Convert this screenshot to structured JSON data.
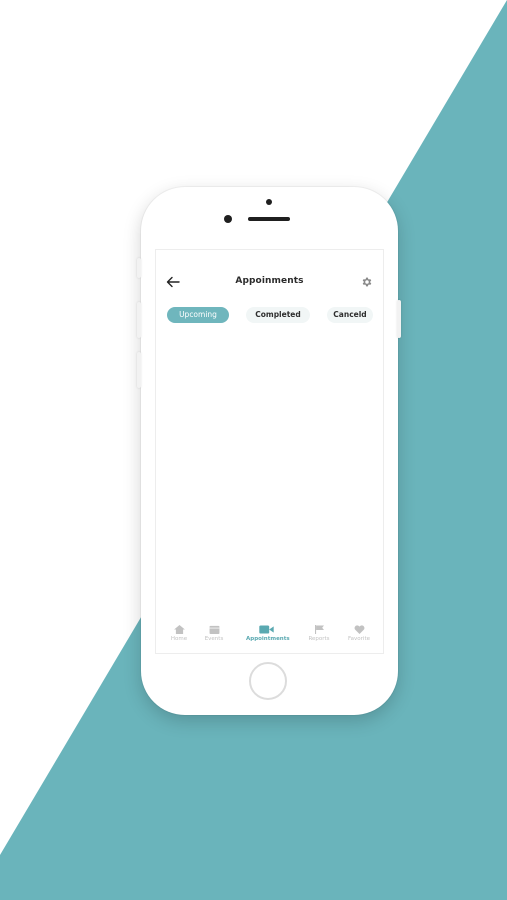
{
  "colors": {
    "accent": "#6fb6bd",
    "background_shape": "#6ab4bb",
    "tab_inactive_bg": "#f1f6f6",
    "nav_inactive": "#c2c2c2"
  },
  "header": {
    "title": "Appoinments",
    "back_icon": "arrow-left-icon",
    "settings_icon": "gear-icon"
  },
  "tabs": [
    {
      "label": "Upcoming",
      "active": true
    },
    {
      "label": "Completed",
      "active": false
    },
    {
      "label": "Canceld",
      "active": false
    }
  ],
  "bottom_nav": [
    {
      "label": "Home",
      "icon": "home-icon",
      "active": false
    },
    {
      "label": "Events",
      "icon": "calendar-icon",
      "active": false
    },
    {
      "label": "Appointments",
      "icon": "video-camera-icon",
      "active": true
    },
    {
      "label": "Reports",
      "icon": "flag-icon",
      "active": false
    },
    {
      "label": "Favorite",
      "icon": "heart-icon",
      "active": false
    }
  ]
}
